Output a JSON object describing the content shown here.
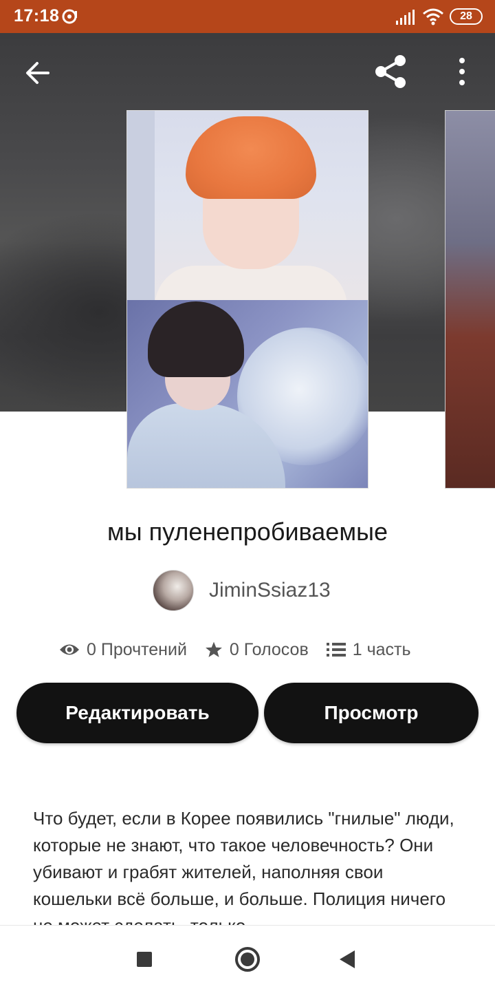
{
  "status_bar": {
    "time": "17:18",
    "battery": "28",
    "background_color": "#b5461a"
  },
  "header": {
    "back_icon": "arrow-left-icon",
    "share_icon": "share-icon",
    "more_icon": "more-vertical-icon"
  },
  "story": {
    "title": "мы пуленепробиваемые",
    "author": "JiminSsiaz13",
    "stats": {
      "reads": "0 Прочтений",
      "votes": "0 Голосов",
      "parts": "1 часть"
    },
    "description": "Что будет, если в Корее появились \"гнилые\" люди, которые не знают, что такое человечность? Они убивают и грабят жителей, наполняя свои кошельки всё больше, и больше. Полиция ничего не может сделать, только"
  },
  "actions": {
    "edit_label": "Редактировать",
    "view_label": "Просмотр"
  },
  "nav_bar": {
    "recents_icon": "square-icon",
    "home_icon": "circle-home-icon",
    "back_icon": "triangle-back-icon"
  }
}
